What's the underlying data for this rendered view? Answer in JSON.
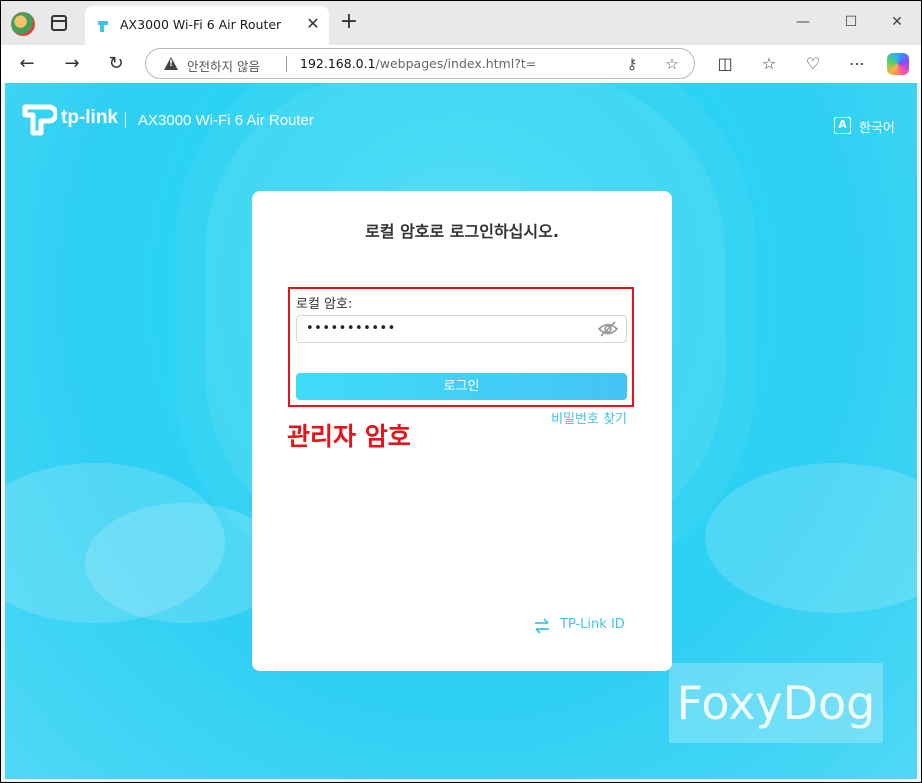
{
  "browser": {
    "tab": {
      "title": "AX3000 Wi-Fi 6 Air Router",
      "close": "✕"
    },
    "new_tab": "+",
    "window_controls": {
      "minimize": "—",
      "maximize": "☐",
      "close": "✕"
    },
    "address_bar": {
      "security_label": "안전하지 않음",
      "url_host": "192.168.0.1",
      "url_path": "/webpages/index.html?t="
    }
  },
  "page": {
    "brand": {
      "name": "tp-link",
      "model": "AX3000 Wi-Fi 6 Air Router"
    },
    "language": {
      "icon_letter": "A",
      "label": "한국어"
    },
    "login": {
      "title": "로컬 암호로 로그인하십시오.",
      "password_label": "로컬 암호:",
      "password_value": "•••••••••••",
      "login_button": "로그인",
      "find_password": "비밀번호 찾기",
      "tplink_id": "TP-Link ID"
    },
    "annotation": "관리자 암호",
    "watermark": "FoxyDog"
  },
  "colors": {
    "accent": "#3fdcf8",
    "highlight_red": "#e4141b",
    "link": "#3fc3ea"
  }
}
